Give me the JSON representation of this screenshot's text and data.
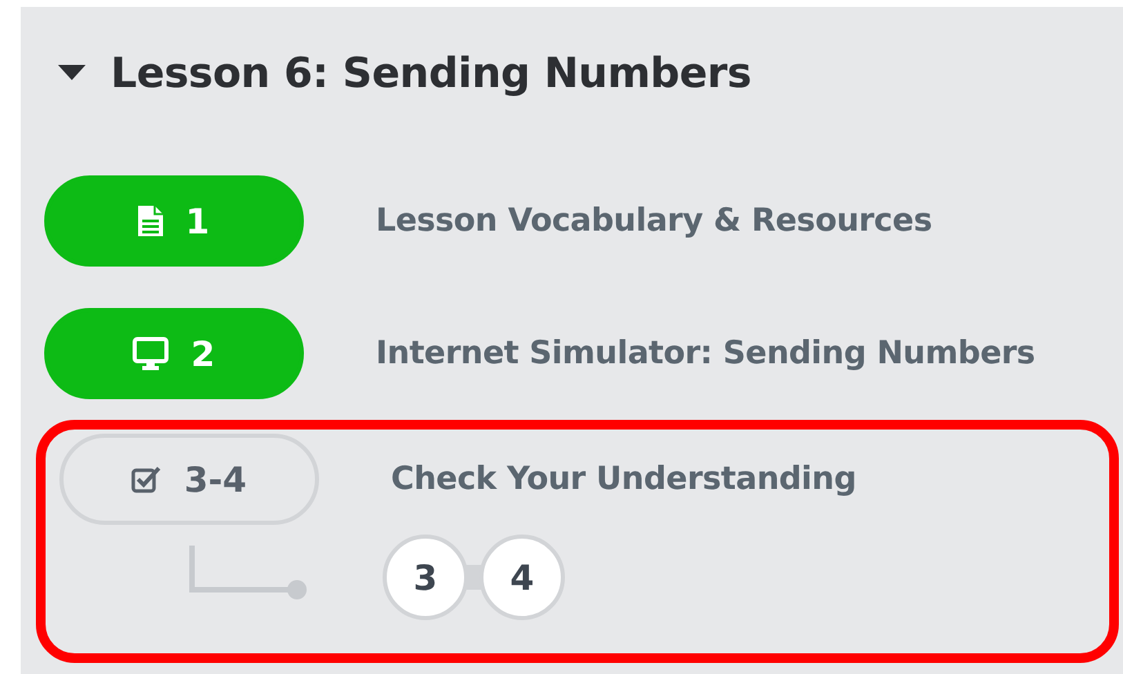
{
  "lesson": {
    "title": "Lesson 6: Sending Numbers",
    "expanded": true
  },
  "levels": [
    {
      "kind": "document",
      "number": "1",
      "title": "Lesson Vocabulary & Resources",
      "completed": true,
      "highlighted": false
    },
    {
      "kind": "computer",
      "number": "2",
      "title": "Internet Simulator: Sending Numbers",
      "completed": true,
      "highlighted": false
    },
    {
      "kind": "checklist",
      "number": "3-4",
      "title": "Check Your Understanding",
      "completed": false,
      "highlighted": true,
      "sublevels": [
        {
          "number": "3"
        },
        {
          "number": "4"
        }
      ]
    }
  ]
}
